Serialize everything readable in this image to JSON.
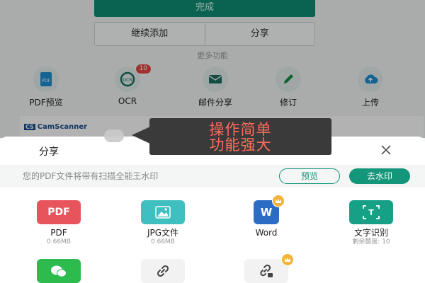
{
  "top": {
    "done_label": "完成",
    "continue_add_label": "继续添加",
    "share_label": "分享",
    "more_features_title": "更多功能"
  },
  "features": [
    {
      "label": "PDF预览",
      "icon": "pdf-file-icon"
    },
    {
      "label": "OCR",
      "icon": "ocr-scan-icon",
      "badge": "10"
    },
    {
      "label": "邮件分享",
      "icon": "mail-icon"
    },
    {
      "label": "修订",
      "icon": "pencil-icon"
    },
    {
      "label": "上传",
      "icon": "cloud-upload-icon"
    }
  ],
  "banner": {
    "logo_prefix": "CS",
    "logo_text": "CamScanner"
  },
  "callout": {
    "line1": "操作简单",
    "line2": "功能强大"
  },
  "share_sheet": {
    "title": "分享",
    "watermark_notice": "您的PDF文件将带有扫描全能王水印",
    "preview_label": "预览",
    "remove_watermark_label": "去水印",
    "options": [
      {
        "tile_text": "PDF",
        "name": "PDF",
        "sub": "0.66MB",
        "color": "#e8545b",
        "icon": "pdf-icon"
      },
      {
        "tile_text": "",
        "name": "JPG文件",
        "sub": "0.66MB",
        "color": "#3fbfbf",
        "icon": "image-icon"
      },
      {
        "tile_text": "W",
        "name": "Word",
        "sub": "",
        "color": "#2b6cc4",
        "icon": "word-icon",
        "premium": true
      },
      {
        "tile_text": "T",
        "name": "文字识别",
        "sub": "剩余额度: 10",
        "color": "#16a085",
        "icon": "text-recognition-icon"
      }
    ],
    "options_row2": [
      {
        "icon": "wechat-icon",
        "color": "#2dbb4e"
      },
      {
        "icon": "link-icon",
        "color": "#f2f2f2"
      },
      {
        "icon": "locked-link-icon",
        "color": "#f2f2f2",
        "premium": true
      }
    ]
  },
  "colors": {
    "accent": "#13967a",
    "callout_text": "#ff6b5a"
  }
}
